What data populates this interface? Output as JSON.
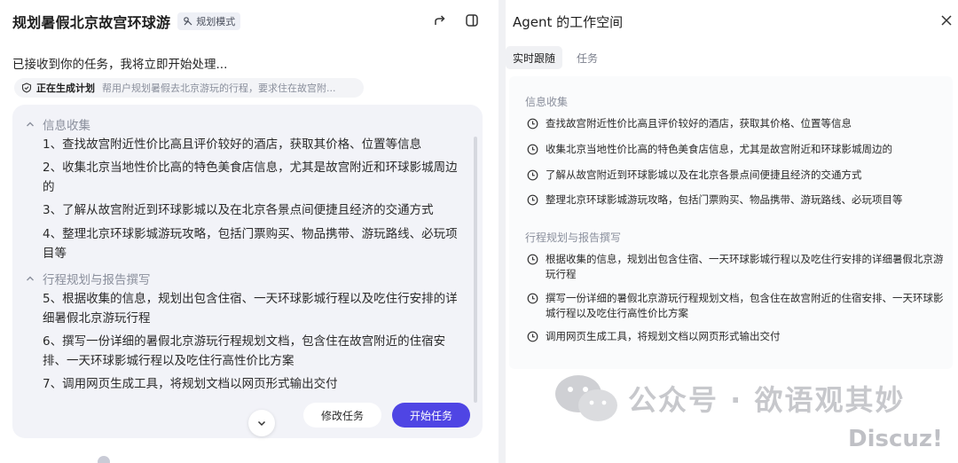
{
  "left": {
    "title": "规划暑假北京故宫环球游",
    "mode_badge": "规划模式",
    "received_msg": "已接收到你的任务，我将立即开始处理...",
    "status": {
      "label": "正在生成计划",
      "desc": "帮用户规划暑假去北京游玩的行程，要求住在故宫附..."
    },
    "plan": {
      "sections": [
        {
          "title": "信息收集",
          "tasks": [
            "1、查找故宫附近性价比高且评价较好的酒店，获取其价格、位置等信息",
            "2、收集北京当地性价比高的特色美食店信息，尤其是故宫附近和环球影城周边的",
            "3、了解从故宫附近到环球影城以及在北京各景点间便捷且经济的交通方式",
            "4、整理北京环球影城游玩攻略，包括门票购买、物品携带、游玩路线、必玩项目等"
          ]
        },
        {
          "title": "行程规划与报告撰写",
          "tasks": [
            "5、根据收集的信息，规划出包含住宿、一天环球影城行程以及吃住行安排的详细暑假北京游玩行程",
            "6、撰写一份详细的暑假北京游玩行程规划文档，包含住在故宫附近的住宿安排、一天环球影城行程以及吃住行高性价比方案",
            "7、调用网页生成工具，将规划文档以网页形式输出交付"
          ]
        }
      ],
      "modify_label": "修改任务",
      "start_label": "开始任务"
    }
  },
  "right": {
    "title": "Agent 的工作空间",
    "tabs": [
      "实时跟随",
      "任务"
    ],
    "active_tab": 0,
    "feed": [
      {
        "title": "信息收集",
        "items": [
          "查找故宫附近性价比高且评价较好的酒店，获取其价格、位置等信息",
          "收集北京当地性价比高的特色美食店信息，尤其是故宫附近和环球影城周边的",
          "了解从故宫附近到环球影城以及在北京各景点间便捷且经济的交通方式",
          "整理北京环球影城游玩攻略，包括门票购买、物品携带、游玩路线、必玩项目等"
        ]
      },
      {
        "title": "行程规划与报告撰写",
        "items": [
          "根据收集的信息，规划出包含住宿、一天环球影城行程以及吃住行安排的详细暑假北京游玩行程",
          "撰写一份详细的暑假北京游玩行程规划文档，包含住在故宫附近的住宿安排、一天环球影城行程以及吃住行高性价比方案",
          "调用网页生成工具，将规划文档以网页形式输出交付"
        ]
      }
    ]
  },
  "watermark": {
    "wechat": "公众号 · 欲语观其妙",
    "forum": "Discuz!"
  },
  "colors": {
    "primary": "#4f45e4",
    "card_bg": "#f2f3f8",
    "muted": "#8a8f9c"
  }
}
